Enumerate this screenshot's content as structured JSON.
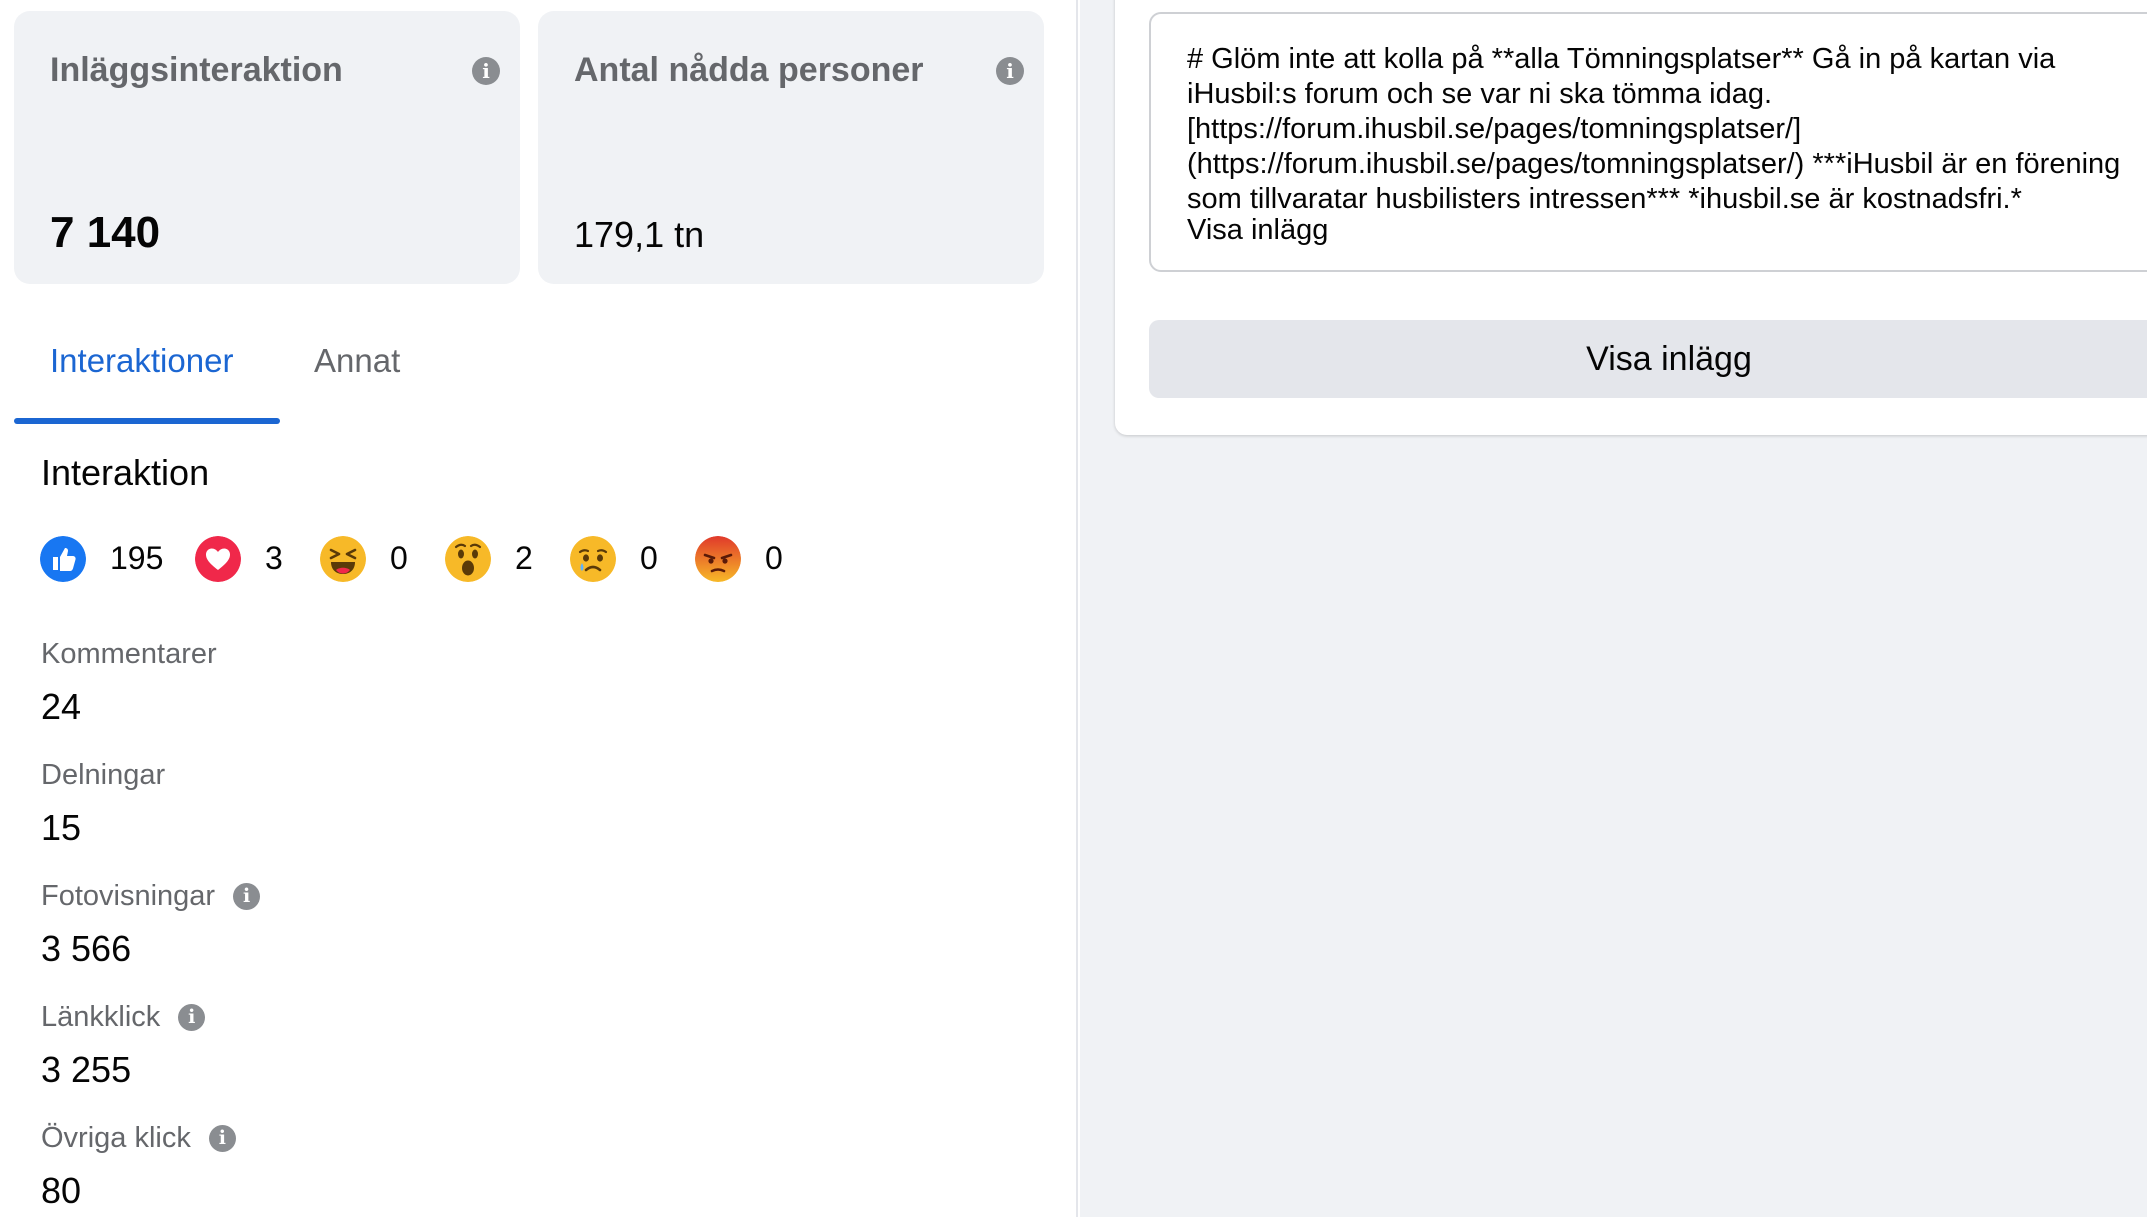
{
  "cards": {
    "interaction": {
      "title": "Inläggsinteraktion",
      "value": "7 140"
    },
    "reach": {
      "title": "Antal nådda personer",
      "value": "179,1 tn"
    }
  },
  "tabs": [
    {
      "label": "Interaktioner",
      "active": true
    },
    {
      "label": "Annat",
      "active": false
    }
  ],
  "section_title": "Interaktion",
  "reactions": [
    {
      "icon": "like-icon",
      "count": "195"
    },
    {
      "icon": "love-icon",
      "count": "3"
    },
    {
      "icon": "haha-icon",
      "count": "0"
    },
    {
      "icon": "wow-icon",
      "count": "2"
    },
    {
      "icon": "sad-icon",
      "count": "0"
    },
    {
      "icon": "angry-icon",
      "count": "0"
    }
  ],
  "stats": [
    {
      "label": "Kommentarer",
      "value": "24",
      "info": false
    },
    {
      "label": "Delningar",
      "value": "15",
      "info": false
    },
    {
      "label": "Fotovisningar",
      "value": "3 566",
      "info": true
    },
    {
      "label": "Länkklick",
      "value": "3 255",
      "info": true
    },
    {
      "label": "Övriga klick",
      "value": "80",
      "info": true
    }
  ],
  "post": {
    "text": "# Glöm inte att kolla på **alla Tömningsplatser** Gå in på kartan via iHusbil:s forum och se var ni ska tömma idag. [https://forum.ihusbil.se/pages/tomningsplatser/](https://forum.ihusbil.se/pages/tomningsplatser/) ***iHusbil är en förening som tillvaratar husbilisters intressen*** *ihusbil.se är kostnadsfri.*",
    "more_label": "Visa inlägg",
    "button_label": "Visa inlägg"
  },
  "colors": {
    "accent": "#1b66d2",
    "like": "#1877f2",
    "love": "#f0284a",
    "emoji_yellow": "#f7b928",
    "angry": "#e9710f"
  }
}
